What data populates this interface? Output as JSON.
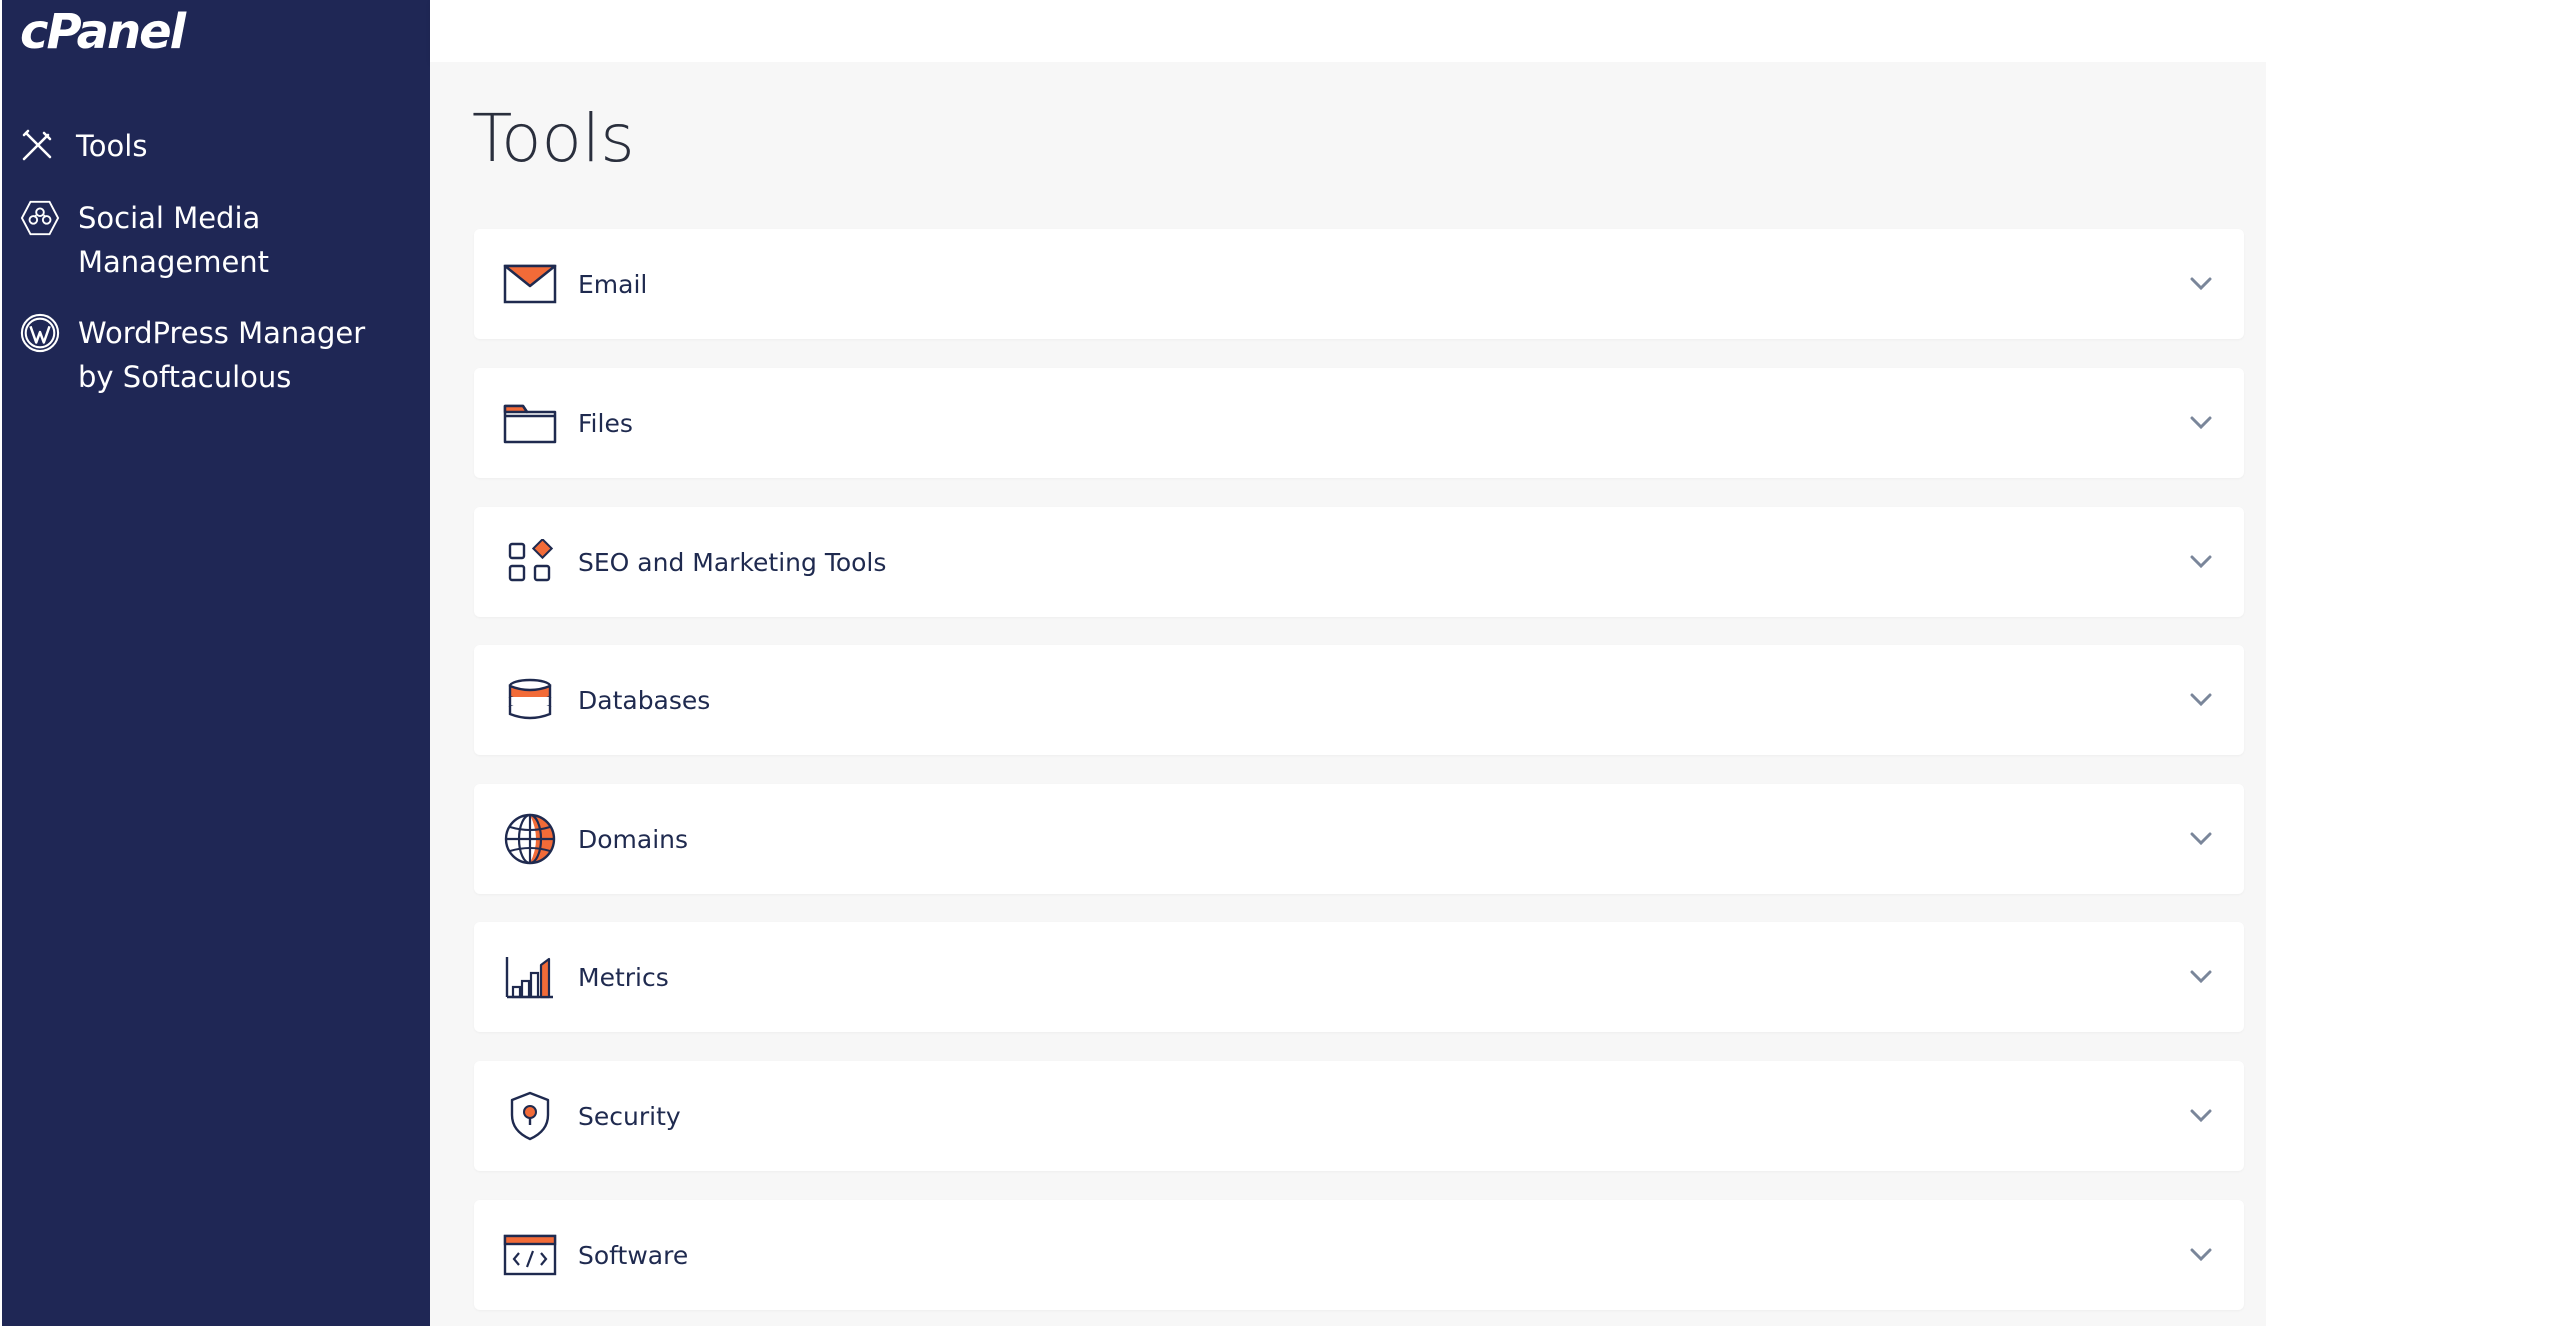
{
  "brand": {
    "logo_text": "cPanel"
  },
  "sidebar": {
    "items": [
      {
        "label": "Tools",
        "icon": "tools-icon"
      },
      {
        "label": "Social Media Management",
        "icon": "social-media-icon"
      },
      {
        "label": "WordPress Manager by Softaculous",
        "icon": "wordpress-icon"
      }
    ]
  },
  "main": {
    "title": "Tools",
    "sections": [
      {
        "label": "Email",
        "icon": "email-icon"
      },
      {
        "label": "Files",
        "icon": "folder-icon"
      },
      {
        "label": "SEO and Marketing Tools",
        "icon": "seo-icon"
      },
      {
        "label": "Databases",
        "icon": "database-icon"
      },
      {
        "label": "Domains",
        "icon": "globe-icon"
      },
      {
        "label": "Metrics",
        "icon": "metrics-icon"
      },
      {
        "label": "Security",
        "icon": "shield-icon"
      },
      {
        "label": "Software",
        "icon": "code-icon"
      }
    ]
  },
  "colors": {
    "sidebar_bg": "#1f2755",
    "accent": "#f26b38",
    "card_bg": "#ffffff",
    "main_bg": "#f7f7f7",
    "chevron": "#7a869a"
  }
}
